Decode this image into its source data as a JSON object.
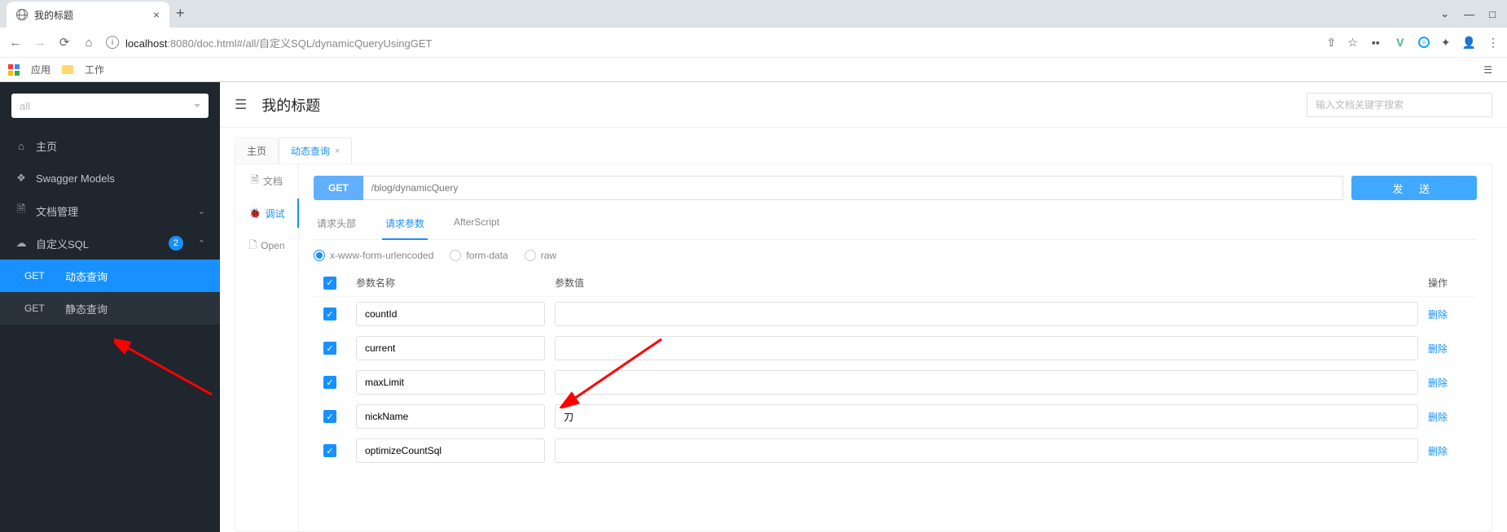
{
  "browser": {
    "tab_title": "我的标题",
    "url_host": "localhost",
    "url_port": ":8080",
    "url_path": "/doc.html#/all/自定义SQL/dynamicQueryUsingGET",
    "bookmark_apps": "应用",
    "bookmark_work": "工作"
  },
  "sidebar": {
    "dropdown": "all",
    "home": "主页",
    "swagger_models": "Swagger Models",
    "doc_manage": "文档管理",
    "custom_sql": "自定义SQL",
    "badge_count": "2",
    "sub_dynamic_method": "GET",
    "sub_dynamic_label": "动态查询",
    "sub_static_method": "GET",
    "sub_static_label": "静态查询"
  },
  "header": {
    "title": "我的标题",
    "search_placeholder": "输入文档关键字搜索"
  },
  "tabs": {
    "home": "主页",
    "dynamic": "动态查询"
  },
  "subtabs": {
    "doc": "文档",
    "debug": "调试",
    "open": "Open"
  },
  "request": {
    "method": "GET",
    "url": "/blog/dynamicQuery",
    "send": "发 送"
  },
  "inner_tabs": {
    "headers": "请求头部",
    "params": "请求参数",
    "after": "AfterScript"
  },
  "body_types": {
    "urlencoded": "x-www-form-urlencoded",
    "formdata": "form-data",
    "raw": "raw"
  },
  "table": {
    "col_name": "参数名称",
    "col_value": "参数值",
    "col_action": "操作",
    "delete": "删除",
    "rows": [
      {
        "name": "countId",
        "value": ""
      },
      {
        "name": "current",
        "value": ""
      },
      {
        "name": "maxLimit",
        "value": ""
      },
      {
        "name": "nickName",
        "value": "刀"
      },
      {
        "name": "optimizeCountSql",
        "value": ""
      }
    ]
  }
}
